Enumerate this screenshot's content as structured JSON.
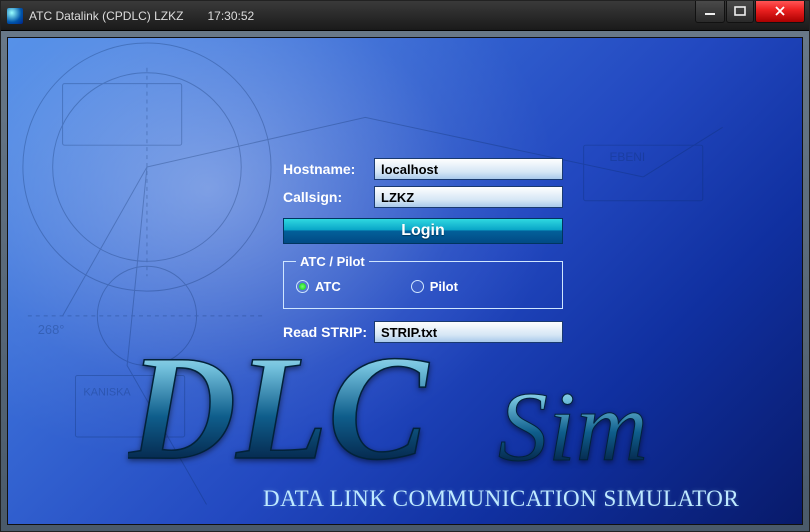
{
  "window": {
    "title": "ATC Datalink (CPDLC) LZKZ",
    "time": "17:30:52"
  },
  "form": {
    "hostname_label": "Hostname:",
    "hostname_value": "localhost",
    "callsign_label": "Callsign:",
    "callsign_value": "LZKZ",
    "login_label": "Login",
    "mode_legend": "ATC / Pilot",
    "atc_label": "ATC",
    "pilot_label": "Pilot",
    "mode_selected": "ATC",
    "strip_label": "Read STRIP:",
    "strip_value": "STRIP.txt"
  },
  "branding": {
    "logo_main": "DLC",
    "logo_suffix": "Sim",
    "tagline": "DATA LINK COMMUNICATION SIMULATOR"
  }
}
